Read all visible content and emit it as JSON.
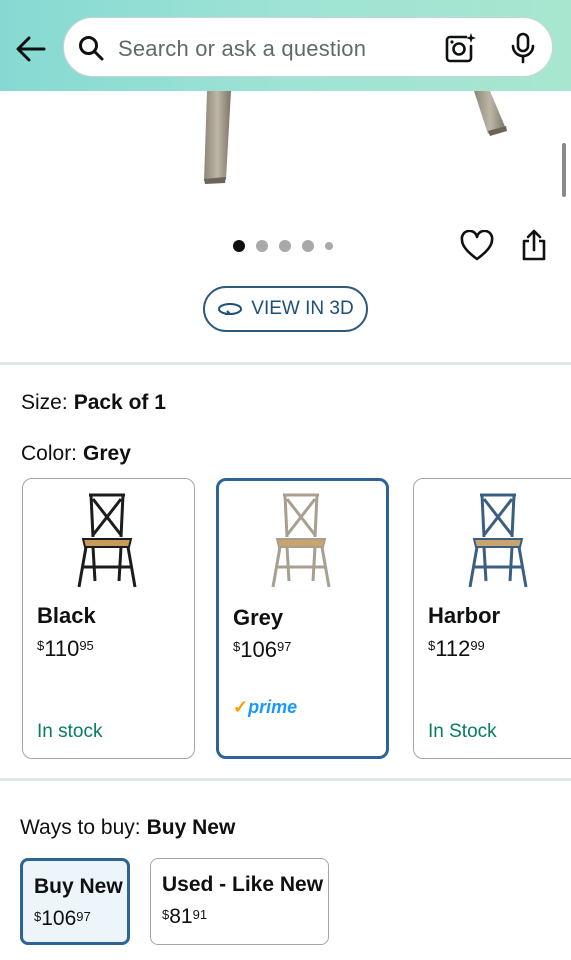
{
  "search": {
    "placeholder": "Search or ask a question"
  },
  "gallery": {
    "dots": 5,
    "active_index": 0,
    "view3d_label": "VIEW IN 3D"
  },
  "size": {
    "label": "Size:",
    "value": "Pack of 1"
  },
  "color": {
    "label": "Color:",
    "value": "Grey"
  },
  "swatches": [
    {
      "name": "Black",
      "currency": "$",
      "dollars": "110",
      "cents": "95",
      "status": "In stock",
      "chair_color": "#1c1c1c",
      "seat_color": "#c79a5b"
    },
    {
      "name": "Grey",
      "currency": "$",
      "dollars": "106",
      "cents": "97",
      "badge": "prime",
      "chair_color": "#a89f8f",
      "seat_color": "#c9a46e",
      "selected": true
    },
    {
      "name": "Harbor",
      "currency": "$",
      "dollars": "112",
      "cents": "99",
      "status": "In Stock",
      "chair_color": "#3b5f82",
      "seat_color": "#c9a46e"
    }
  ],
  "ways_to_buy": {
    "label": "Ways to buy:",
    "value": "Buy New",
    "options": [
      {
        "name": "Buy New",
        "currency": "$",
        "dollars": "106",
        "cents": "97",
        "selected": true
      },
      {
        "name": "Used - Like New",
        "currency": "$",
        "dollars": "81",
        "cents": "91"
      }
    ]
  },
  "colors": {
    "accent": "#2d6396",
    "stock": "#067d62",
    "prime": "#1a98ff",
    "prime_check": "#ff9900"
  }
}
